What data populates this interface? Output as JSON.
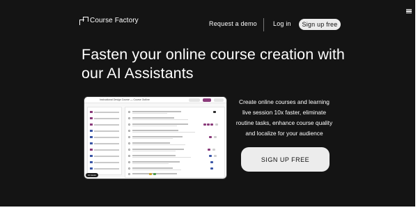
{
  "brand": {
    "name": "Course Factory",
    "icon": "course-factory-logo-icon"
  },
  "nav": {
    "request_demo": "Request a demo",
    "login": "Log in",
    "signup": "Sign up free",
    "menu_icon": "hamburger-menu-icon"
  },
  "hero": {
    "headline": "Fasten your online course creation with our AI Assistants",
    "description": "Create online courses and learning live session 10x faster, eliminate routine tasks, enhance course quality and localize for your audience",
    "cta": "SIGN UP FREE"
  },
  "preview": {
    "title": "Instructional Design Course — Course Outline",
    "chip": "AI Assist"
  },
  "colors": {
    "background": "#141414",
    "text": "#ffffff",
    "button_bg": "#ececec",
    "button_text": "#111111",
    "accent_tag": "#8a3a7a"
  }
}
